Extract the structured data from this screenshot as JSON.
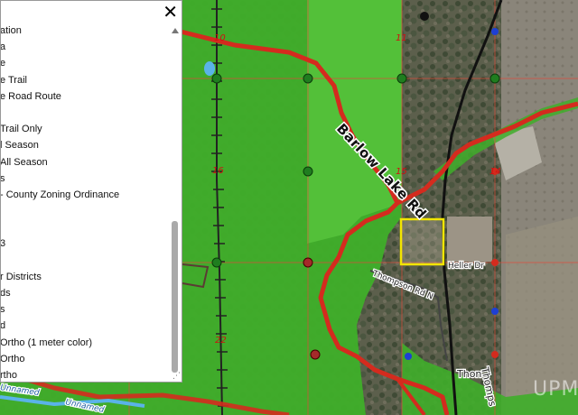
{
  "legend": {
    "close_label": "✕",
    "items": [
      "ation",
      "a",
      "e",
      "e Trail",
      "e Road Route",
      "",
      "Trail Only",
      "l Season",
      "All Season",
      "s",
      "- County Zoning Ordinance",
      "",
      "",
      "3",
      "",
      "r Districts",
      "ds",
      "s",
      "d",
      "Ortho (1 meter color)",
      "Ortho",
      "rtho"
    ],
    "resize_glyph": "⋰"
  },
  "map": {
    "road_label": "Barlow Lake Rd",
    "street_labels": [
      "Heller Dr",
      "Thompson Rd N",
      "Thon",
      "Thomps"
    ],
    "section_numbers": [
      "10",
      "11",
      "15",
      "16",
      "14",
      "22"
    ],
    "creek_labels": [
      "Unnamed",
      "Unnamed"
    ],
    "watermark": "UPM",
    "colors": {
      "zoning_green": "#3fae2a",
      "trail_red": "#d42b1e",
      "parcel_yellow": "#f2e600",
      "road_black": "#111111"
    }
  }
}
